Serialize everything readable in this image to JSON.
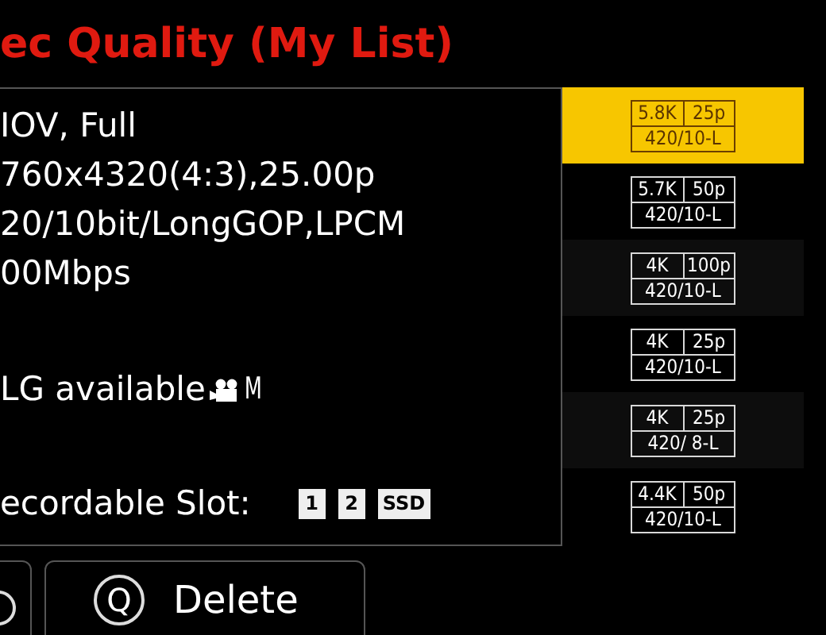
{
  "title": "ec Quality (My List)",
  "details": [
    "IOV, Full",
    "760x4320(4:3),25.00p",
    "20/10bit/LongGOP,LPCM",
    "00Mbps"
  ],
  "log_line": {
    "text": "LG available",
    "mode": "M"
  },
  "slots": {
    "label": "ecordable Slot:",
    "badges": [
      "1",
      "2",
      "SSD"
    ]
  },
  "presets": [
    {
      "resolution": "5.8K",
      "frame_rate": "25p",
      "codec": "420/10-L",
      "selected": true
    },
    {
      "resolution": "5.7K",
      "frame_rate": "50p",
      "codec": "420/10-L",
      "selected": false
    },
    {
      "resolution": "4K",
      "frame_rate": "100p",
      "codec": "420/10-L",
      "selected": false
    },
    {
      "resolution": "4K",
      "frame_rate": "25p",
      "codec": "420/10-L",
      "selected": false
    },
    {
      "resolution": "4K",
      "frame_rate": "25p",
      "codec": "420/ 8-L",
      "selected": false
    },
    {
      "resolution": "4.4K",
      "frame_rate": "50p",
      "codec": "420/10-L",
      "selected": false
    }
  ],
  "delete_button": {
    "key": "Q",
    "label": "Delete"
  }
}
